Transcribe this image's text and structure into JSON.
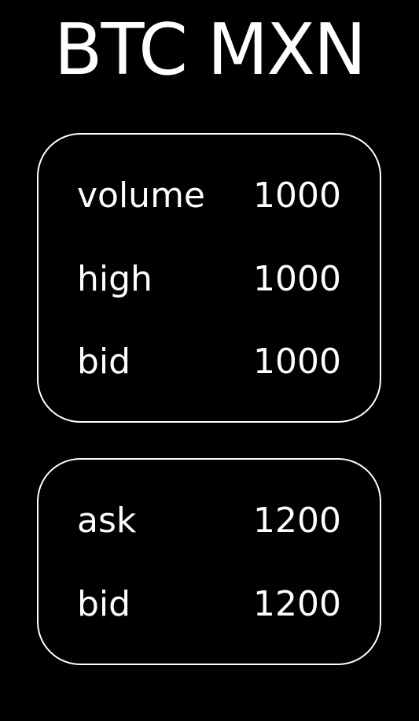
{
  "title": "BTC MXN",
  "ticker": {
    "rows": [
      {
        "label": "volume",
        "value": "1000"
      },
      {
        "label": "high",
        "value": "1000"
      },
      {
        "label": "bid",
        "value": "1000"
      }
    ]
  },
  "orderbook": {
    "rows": [
      {
        "label": "ask",
        "value": "1200"
      },
      {
        "label": "bid",
        "value": "1200"
      }
    ]
  },
  "colors": {
    "background": "#000000",
    "foreground": "#ffffff"
  }
}
